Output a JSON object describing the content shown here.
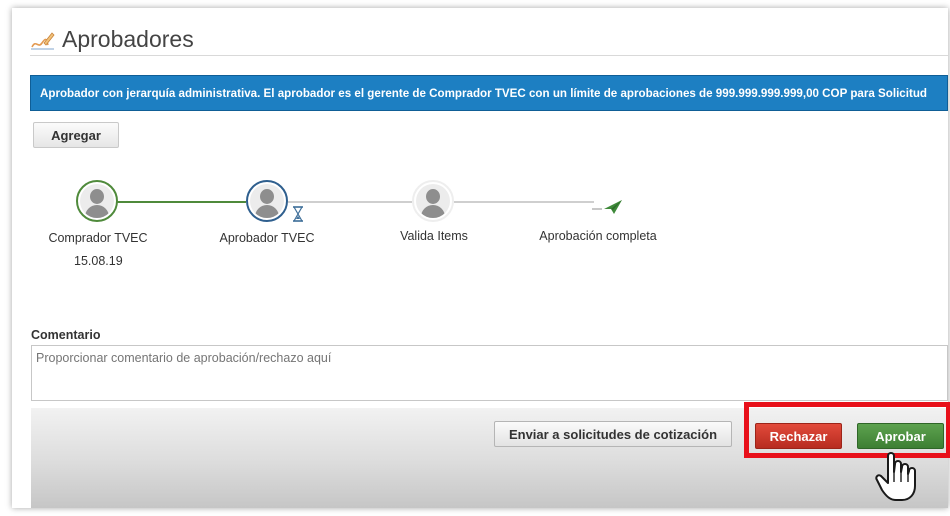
{
  "header": {
    "title": "Aprobadores",
    "icon": "signature-icon"
  },
  "info_bar": {
    "text": "Aprobador con jerarquía administrativa. El aprobador es el gerente de Comprador TVEC con un límite de aprobaciones de 999.999.999.999,00 COP para Solicitud"
  },
  "add_button": {
    "label": "Agregar"
  },
  "workflow": {
    "steps": [
      {
        "label": "Comprador TVEC",
        "date": "15.08.19",
        "status": "completed"
      },
      {
        "label": "Aprobador TVEC",
        "status": "pending",
        "status_icon": "hourglass-icon"
      },
      {
        "label": "Valida Items",
        "status": "future"
      },
      {
        "label": "Aprobación completa",
        "status": "future",
        "icon": "paper-plane-icon"
      }
    ]
  },
  "comment": {
    "label": "Comentario",
    "placeholder": "Proporcionar comentario de aprobación/rechazo aquí"
  },
  "actions": {
    "quote_label": "Enviar a solicitudes de cotización",
    "reject_label": "Rechazar",
    "approve_label": "Aprobar"
  },
  "colors": {
    "info_bar": "#1d7fc2",
    "completed": "#4f8a3b",
    "pending": "#2f5f8e",
    "reject": "#c93628",
    "approve": "#4b8f41",
    "highlight": "#e8101a"
  }
}
